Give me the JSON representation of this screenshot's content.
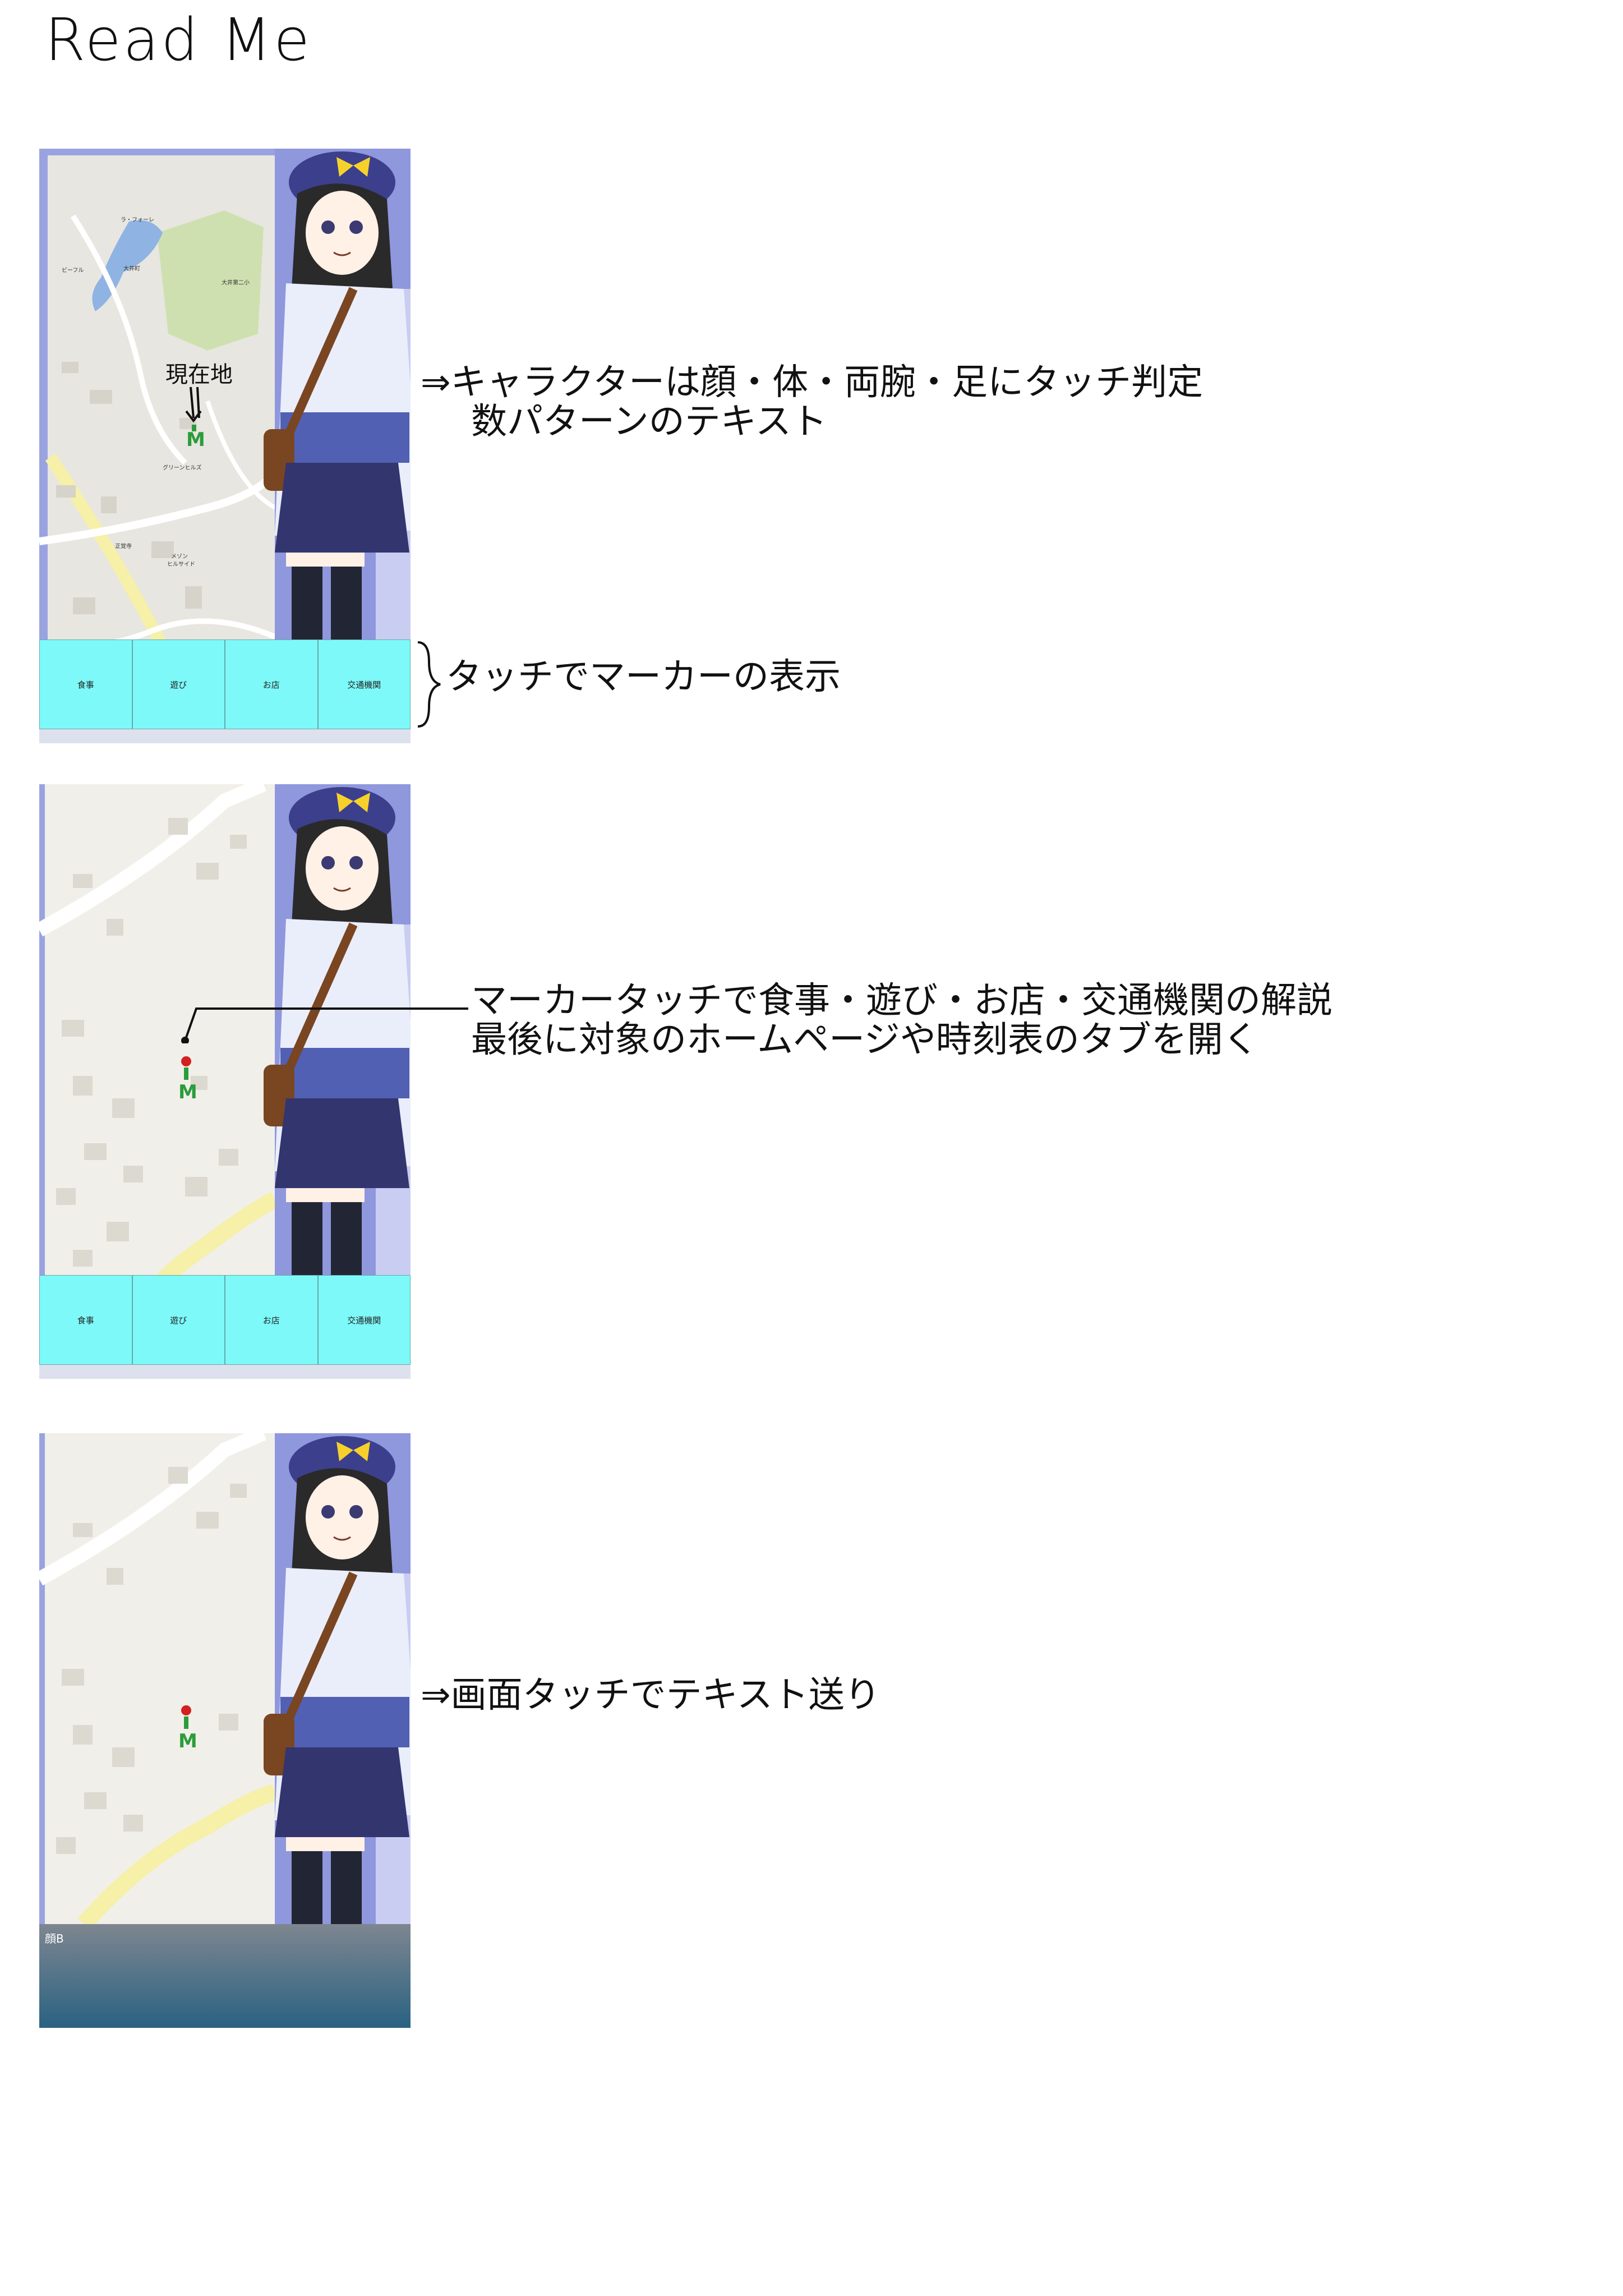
{
  "page_title": "Read Me",
  "notes": {
    "note1_line1": "⇒キャラクターは顔・体・両腕・足にタッチ判定",
    "note1_line2": "数パターンのテキスト",
    "note2": "タッチでマーカーの表示",
    "note3_line1": "マーカータッチで食事・遊び・お店・交通機関の解説",
    "note3_line2": "最後に対象のホームページや時刻表のタブを開く",
    "note4": "⇒画面タッチでテキスト送り"
  },
  "screen1": {
    "current_location_label": "現在地",
    "map_labels": [
      "ラ・フォーレ",
      "ビーフル",
      "大井町",
      "大井第二小",
      "グリーンヒルズ",
      "メゾン",
      "ヒルサイド",
      "正覚寺"
    ],
    "menu": [
      "食事",
      "遊び",
      "お店",
      "交通機関"
    ]
  },
  "screen2": {
    "menu": [
      "食事",
      "遊び",
      "お店",
      "交通機関"
    ]
  },
  "screen3": {
    "message_text": "顔B"
  },
  "colors": {
    "menu_button": "#7df9f9",
    "screen_bg": "#8f97dd",
    "marker_green": "#2a9d3a",
    "marker_red": "#d42020"
  }
}
